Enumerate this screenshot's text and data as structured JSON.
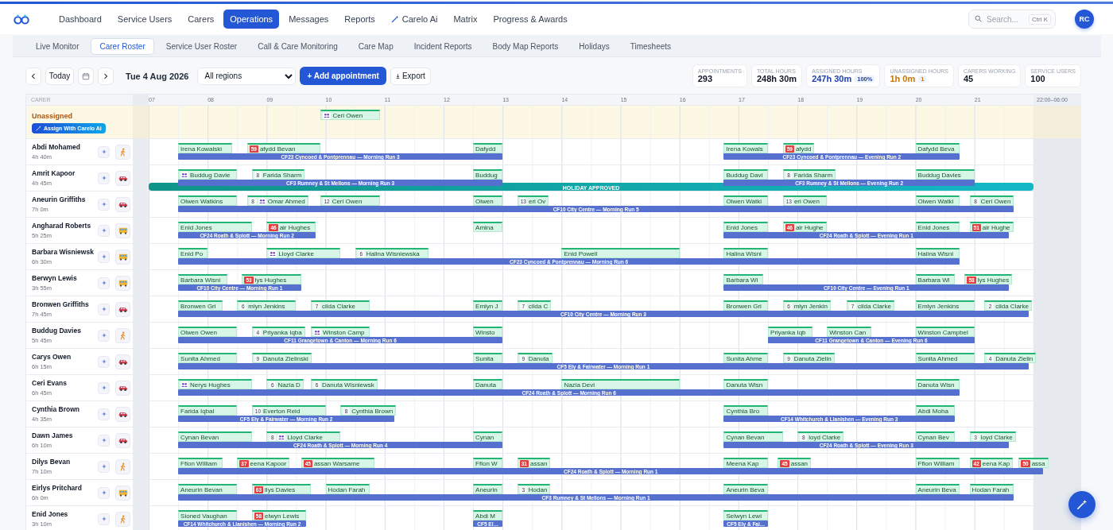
{
  "nav": {
    "items": [
      {
        "label": "Dashboard",
        "selected": false,
        "kind": "plain"
      },
      {
        "label": "Service Users",
        "selected": false,
        "kind": "plain"
      },
      {
        "label": "Carers",
        "selected": false,
        "kind": "plain"
      },
      {
        "label": "Operations",
        "selected": true,
        "kind": "plain"
      },
      {
        "label": "Messages",
        "selected": false,
        "kind": "plain"
      },
      {
        "label": "Reports",
        "selected": false,
        "kind": "plain"
      },
      {
        "label": "Carelo Ai",
        "selected": false,
        "kind": "ai"
      },
      {
        "label": "Matrix",
        "selected": false,
        "kind": "plain"
      },
      {
        "label": "Progress & Awards",
        "selected": false,
        "kind": "plain"
      }
    ]
  },
  "search": {
    "placeholder": "Search...",
    "shortcut": "Ctrl K"
  },
  "user": {
    "initials": "RC"
  },
  "subnav": [
    {
      "label": "Live Monitor",
      "selected": false
    },
    {
      "label": "Carer Roster",
      "selected": true
    },
    {
      "label": "Service User Roster",
      "selected": false
    },
    {
      "label": "Call & Care Monitoring",
      "selected": false
    },
    {
      "label": "Care Map",
      "selected": false
    },
    {
      "label": "Incident Reports",
      "selected": false
    },
    {
      "label": "Body Map Reports",
      "selected": false
    },
    {
      "label": "Holidays",
      "selected": false
    },
    {
      "label": "Timesheets",
      "selected": false
    }
  ],
  "toolbar": {
    "today": "Today",
    "date": "Tue 4 Aug 2026",
    "region": "All regions",
    "add": "+ Add appointment",
    "export": "Export"
  },
  "stats": [
    {
      "label": "APPOINTMENTS",
      "value": "293",
      "color": "#111827"
    },
    {
      "label": "TOTAL HOURS",
      "value": "248h 30m",
      "color": "#111827"
    },
    {
      "label": "ASSIGNED HOURS",
      "value": "247h 30m",
      "color": "#1e40af",
      "badge": "100%"
    },
    {
      "label": "UNASSIGNED HOURS",
      "value": "1h 0m",
      "color": "#c2780c",
      "badge": "1"
    },
    {
      "label": "CARERS WORKING",
      "value": "45",
      "color": "#111827"
    },
    {
      "label": "SERVICE USERS",
      "value": "100",
      "color": "#111827"
    }
  ],
  "roster": {
    "carer_header": "CARER",
    "hours": [
      "07",
      "08",
      "09",
      "10",
      "11",
      "12",
      "13",
      "14",
      "15",
      "16",
      "17",
      "18",
      "19",
      "20",
      "21"
    ],
    "night": "22:00–06:00",
    "unassigned": {
      "label": "Unassigned",
      "button": "Assign With Carelo Ai",
      "visits": [
        {
          "name": "Ceri Owen",
          "group_visit": true
        }
      ]
    },
    "carers": [
      {
        "name": "Abdi Mohamed",
        "hours": "4h 40m",
        "kind": "walk",
        "visits": [
          {
            "name": "Irena Kowalski",
            "group_visit": false
          },
          {
            "name": "afydd Bevan",
            "group_visit": false,
            "badge": {
              "text": "59",
              "alert": true
            }
          },
          {
            "name": "Dafydd",
            "group_visit": false
          },
          {
            "name": "Irena Kowals",
            "group_visit": false
          },
          {
            "name": "afydd",
            "group_visit": false,
            "badge": {
              "text": "59",
              "alert": true
            }
          },
          {
            "name": "Dafydd Beva",
            "group_visit": false
          }
        ],
        "runs": [
          "CF23 Cyncoed & Pontprennau — Morning Run 3",
          "CF23 Cyncoed & Pontprennau — Evening Run 2"
        ]
      },
      {
        "name": "Amrit Kapoor",
        "hours": "4h 45m",
        "kind": "car",
        "holiday": "HOLIDAY APPROVED",
        "visits": [
          {
            "name": "Buddug Davie",
            "group_visit": true
          },
          {
            "name": "Farida Sharm",
            "group_visit": false,
            "badge": {
              "text": "8",
              "alert": false
            }
          },
          {
            "name": "Buddug",
            "group_visit": false
          },
          {
            "name": "Buddug Davi",
            "group_visit": false
          },
          {
            "name": "Farida Sharm",
            "group_visit": false,
            "badge": {
              "text": "8",
              "alert": false
            }
          },
          {
            "name": "Buddug Davies",
            "group_visit": false
          }
        ],
        "runs": [
          "CF3 Rumney & St Mellons — Morning Run 3",
          "CF3 Rumney & St Mellons — Evening Run 2"
        ]
      },
      {
        "name": "Aneurin Griffiths",
        "hours": "7h 0m",
        "kind": "car",
        "visits": [
          {
            "name": "Olwen Watkins",
            "group_visit": false
          },
          {
            "name": "Omar Ahmed",
            "group_visit": true,
            "badge": {
              "text": "8",
              "alert": false
            }
          },
          {
            "name": "Ceri Owen",
            "group_visit": false,
            "badge": {
              "text": "12",
              "alert": false
            }
          },
          {
            "name": "Olwen",
            "group_visit": false
          },
          {
            "name": "eri Ov",
            "group_visit": false,
            "badge": {
              "text": "13",
              "alert": false
            }
          },
          {
            "name": "Olwen Watki",
            "group_visit": false
          },
          {
            "name": "eri Owen",
            "group_visit": false,
            "badge": {
              "text": "13",
              "alert": false
            }
          },
          {
            "name": "Olwen Watki",
            "group_visit": false
          },
          {
            "name": "Ceri Owen",
            "group_visit": false,
            "badge": {
              "text": "8",
              "alert": false
            }
          }
        ],
        "runs": [
          "CF10 City Centre — Morning Run 5"
        ]
      },
      {
        "name": "Angharad Roberts",
        "hours": "5h 25m",
        "kind": "bus",
        "visits": [
          {
            "name": "Enid Jones",
            "group_visit": false
          },
          {
            "name": "air Hughes",
            "group_visit": false,
            "badge": {
              "text": "46",
              "alert": true
            }
          },
          {
            "name": "Amina",
            "group_visit": false
          },
          {
            "name": "Enid Jones",
            "group_visit": false
          },
          {
            "name": "air Hughe",
            "group_visit": false,
            "badge": {
              "text": "46",
              "alert": true
            }
          },
          {
            "name": "Enid Jones",
            "group_visit": false
          },
          {
            "name": "air Hughe",
            "group_visit": false,
            "badge": {
              "text": "51",
              "alert": true
            }
          }
        ],
        "runs": [
          "CF24 Roath & Splott — Morning Run 2",
          "CF24 Roath & Splott — Evening Run 1"
        ]
      },
      {
        "name": "Barbara Wisniewsk",
        "hours": "6h 30m",
        "kind": "bus",
        "visits": [
          {
            "name": "Enid Po",
            "group_visit": false
          },
          {
            "name": "Lloyd Clarke",
            "group_visit": true
          },
          {
            "name": "Halina Wisniewska",
            "group_visit": false,
            "badge": {
              "text": "6",
              "alert": false
            }
          },
          {
            "name": "Enid Powell",
            "group_visit": false
          },
          {
            "name": "Halina Wisni",
            "group_visit": false
          },
          {
            "name": "Halina Wisni",
            "group_visit": false
          }
        ],
        "runs": [
          "CF23 Cyncoed & Pontprennau — Morning Run 6"
        ]
      },
      {
        "name": "Berwyn Lewis",
        "hours": "3h 55m",
        "kind": "bus",
        "visits": [
          {
            "name": "Barbara Wisni",
            "group_visit": false
          },
          {
            "name": "lys Hughes",
            "group_visit": false,
            "badge": {
              "text": "53",
              "alert": true
            }
          },
          {
            "name": "Barbara Wi",
            "group_visit": false
          },
          {
            "name": "Barbara Wi",
            "group_visit": false
          },
          {
            "name": "lys Hughes",
            "group_visit": false,
            "badge": {
              "text": "58",
              "alert": true
            }
          }
        ],
        "runs": [
          "CF10 City Centre — Morning Run 1",
          "CF10 City Centre — Evening Run 1"
        ]
      },
      {
        "name": "Bronwen Griffiths",
        "hours": "7h 45m",
        "kind": "car",
        "visits": [
          {
            "name": "Bronwen Gri",
            "group_visit": false
          },
          {
            "name": "mlyn Jenkins",
            "group_visit": false,
            "badge": {
              "text": "6",
              "alert": false
            }
          },
          {
            "name": "cilda Clarke",
            "group_visit": false,
            "badge": {
              "text": "7",
              "alert": false
            }
          },
          {
            "name": "Emlyn J",
            "group_visit": false
          },
          {
            "name": "cilda C",
            "group_visit": false,
            "badge": {
              "text": "7",
              "alert": false
            }
          },
          {
            "name": "Bronwen Gri",
            "group_visit": false
          },
          {
            "name": "mlyn Jenkin",
            "group_visit": false,
            "badge": {
              "text": "6",
              "alert": false
            }
          },
          {
            "name": "cilda Clarke",
            "group_visit": false,
            "badge": {
              "text": "7",
              "alert": false
            }
          },
          {
            "name": "Emlyn Jenkins",
            "group_visit": false
          },
          {
            "name": "cilda Clarke",
            "group_visit": false,
            "badge": {
              "text": "2",
              "alert": false
            }
          }
        ],
        "runs": [
          "CF10 City Centre — Morning Run 3"
        ]
      },
      {
        "name": "Buddug Davies",
        "hours": "5h 45m",
        "kind": "walk",
        "visits": [
          {
            "name": "Olwen Owen",
            "group_visit": false
          },
          {
            "name": "Priyanka Iqba",
            "group_visit": false,
            "badge": {
              "text": "4",
              "alert": false
            }
          },
          {
            "name": "Winston Camp",
            "group_visit": true
          },
          {
            "name": "Winsto",
            "group_visit": false
          },
          {
            "name": "Priyanka Iqb",
            "group_visit": false
          },
          {
            "name": "Winston Can",
            "group_visit": false
          },
          {
            "name": "Winston Campbel",
            "group_visit": false
          }
        ],
        "runs": [
          "CF11 Grangetown & Canton — Morning Run 6",
          "CF11 Grangetown & Canton — Evening Run 6"
        ]
      },
      {
        "name": "Carys Owen",
        "hours": "6h 15m",
        "kind": "car",
        "visits": [
          {
            "name": "Sunita Ahmed",
            "group_visit": false
          },
          {
            "name": "Danuta Zielinski",
            "group_visit": false,
            "badge": {
              "text": "9",
              "alert": false
            }
          },
          {
            "name": "Sunita",
            "group_visit": false
          },
          {
            "name": "Danuta",
            "group_visit": false,
            "badge": {
              "text": "9",
              "alert": false
            }
          },
          {
            "name": "Sunita Ahme",
            "group_visit": false
          },
          {
            "name": "Danuta Zielin",
            "group_visit": false,
            "badge": {
              "text": "9",
              "alert": false
            }
          },
          {
            "name": "Sunita Ahmed",
            "group_visit": false
          },
          {
            "name": "Danuta Zielin",
            "group_visit": false,
            "badge": {
              "text": "4",
              "alert": false
            }
          }
        ],
        "runs": [
          "CF5 Ely & Fairwater — Morning Run 1"
        ]
      },
      {
        "name": "Ceri Evans",
        "hours": "6h 45m",
        "kind": "car",
        "visits": [
          {
            "name": "Nerys Hughes",
            "group_visit": true
          },
          {
            "name": "Nazia D",
            "group_visit": false,
            "badge": {
              "text": "6",
              "alert": false
            }
          },
          {
            "name": "Danuta Wisniewsk",
            "group_visit": false,
            "badge": {
              "text": "6",
              "alert": false
            }
          },
          {
            "name": "Danuta",
            "group_visit": false
          },
          {
            "name": "Nazia Devi",
            "group_visit": false
          },
          {
            "name": "Danuta Wisn",
            "group_visit": false
          },
          {
            "name": "Danuta Wisn",
            "group_visit": false
          }
        ],
        "runs": [
          "CF24 Roath & Splott — Morning Run 6"
        ]
      },
      {
        "name": "Cynthia Brown",
        "hours": "4h 35m",
        "kind": "car",
        "visits": [
          {
            "name": "Farida Iqbal",
            "group_visit": false
          },
          {
            "name": "Everton Reid",
            "group_visit": false,
            "badge": {
              "text": "10",
              "alert": false
            }
          },
          {
            "name": "Cynthia Brown",
            "group_visit": false,
            "badge": {
              "text": "8",
              "alert": false
            }
          },
          {
            "name": "Cynthia Bro",
            "group_visit": false
          },
          {
            "name": "Abdi Moha",
            "group_visit": false
          }
        ],
        "runs": [
          "CF5 Ely & Fairwater — Morning Run 2",
          "CF14 Whitchurch & Llanishen — Evening Run 3"
        ]
      },
      {
        "name": "Dawn James",
        "hours": "6h 10m",
        "kind": "car",
        "visits": [
          {
            "name": "Cynan Bevan",
            "group_visit": false
          },
          {
            "name": "Lloyd Clarke",
            "group_visit": true,
            "badge": {
              "text": "8",
              "alert": false
            }
          },
          {
            "name": "Cynan",
            "group_visit": false
          },
          {
            "name": "Cynan Bevan",
            "group_visit": false
          },
          {
            "name": "loyd Clarke",
            "group_visit": false,
            "badge": {
              "text": "8",
              "alert": false
            }
          },
          {
            "name": "Cynan Bev",
            "group_visit": false
          },
          {
            "name": "loyd Clarke",
            "group_visit": false,
            "badge": {
              "text": "3",
              "alert": false
            }
          }
        ],
        "runs": [
          "CF24 Roath & Splott — Morning Run 4",
          "CF24 Roath & Splott — Evening Run 3"
        ]
      },
      {
        "name": "Dilys Bevan",
        "hours": "7h 10m",
        "kind": "walk",
        "visits": [
          {
            "name": "Ffion William",
            "group_visit": false
          },
          {
            "name": "eena Kapoor",
            "group_visit": false,
            "badge": {
              "text": "37",
              "alert": true
            }
          },
          {
            "name": "assan Warsame",
            "group_visit": false,
            "badge": {
              "text": "45",
              "alert": true
            }
          },
          {
            "name": "Ffion W",
            "group_visit": false
          },
          {
            "name": "assan",
            "group_visit": false,
            "badge": {
              "text": "31",
              "alert": true
            }
          },
          {
            "name": "Meena Kap",
            "group_visit": false
          },
          {
            "name": "assan",
            "group_visit": false,
            "badge": {
              "text": "45",
              "alert": true
            }
          },
          {
            "name": "Ffion William",
            "group_visit": false
          },
          {
            "name": "eena Kap",
            "group_visit": false,
            "badge": {
              "text": "42",
              "alert": true
            }
          },
          {
            "name": "assa",
            "group_visit": false,
            "badge": {
              "text": "50",
              "alert": true
            }
          }
        ],
        "runs": [
          "CF24 Roath & Splott — Morning Run 1"
        ]
      },
      {
        "name": "Eirlys Pritchard",
        "hours": "6h 0m",
        "kind": "bus",
        "visits": [
          {
            "name": "Aneurin Bevan",
            "group_visit": false
          },
          {
            "name": "ilys Davies",
            "group_visit": false,
            "badge": {
              "text": "63",
              "alert": true
            }
          },
          {
            "name": "Hodan Farah",
            "group_visit": false
          },
          {
            "name": "Aneurin",
            "group_visit": false
          },
          {
            "name": "Hodan",
            "group_visit": false,
            "badge": {
              "text": "3",
              "alert": false
            }
          },
          {
            "name": "Aneurin Beva",
            "group_visit": false
          },
          {
            "name": "Aneurin Beva",
            "group_visit": false
          },
          {
            "name": "Hodan Farah",
            "group_visit": false
          }
        ],
        "runs": [
          "CF3 Rumney & St Mellons — Morning Run 1"
        ]
      },
      {
        "name": "Enid Jones",
        "hours": "3h 10m",
        "kind": "walk",
        "visits": [
          {
            "name": "Sioned Vaughan",
            "group_visit": false
          },
          {
            "name": "elwyn Lewis",
            "group_visit": false,
            "badge": {
              "text": "58",
              "alert": true
            }
          },
          {
            "name": "Abdi M",
            "group_visit": false
          },
          {
            "name": "Selwyn Lewi",
            "group_visit": false
          }
        ],
        "runs": [
          "CF14 Whitchurch & Llanishen — Morning Run 2",
          "CF5 El…",
          "CF5 Ely & Fai…"
        ]
      }
    ]
  }
}
